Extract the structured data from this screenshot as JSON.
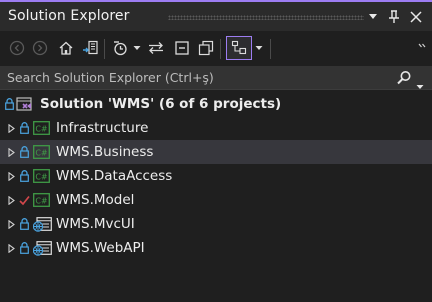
{
  "window": {
    "title": "Solution Explorer",
    "buttons": [
      {
        "name": "window-options-dropdown-icon",
        "glyph": "▾"
      },
      {
        "name": "pin-icon",
        "glyph": "ᵽ"
      },
      {
        "name": "close-icon",
        "glyph": "✕"
      }
    ]
  },
  "toolbar": {
    "items": [
      "back-icon",
      "forward-icon",
      "home-icon",
      "switch-views-icon",
      "pending-changes-filter-icon",
      "sync-with-active-document-icon",
      "collapse-all-icon",
      "show-all-files-icon",
      "properties-icon",
      "preview-selected-items-icon"
    ]
  },
  "search": {
    "placeholder": "Search Solution Explorer (Ctrl+ş)"
  },
  "tree": {
    "root": {
      "label": "Solution 'WMS' (6 of 6 projects)"
    },
    "projects": [
      {
        "label": "Infrastructure",
        "type": "csharp",
        "status": "lock"
      },
      {
        "label": "WMS.Business",
        "type": "csharp",
        "status": "lock",
        "selected": true
      },
      {
        "label": "WMS.DataAccess",
        "type": "csharp",
        "status": "lock"
      },
      {
        "label": "WMS.Model",
        "type": "csharp",
        "status": "check"
      },
      {
        "label": "WMS.MvcUI",
        "type": "web",
        "status": "lock"
      },
      {
        "label": "WMS.WebAPI",
        "type": "web",
        "status": "lock"
      }
    ]
  },
  "colors": {
    "accent": "#9d7df2",
    "csharp_icon": "#3f9b46",
    "web_icon": "#4aa3df",
    "lock": "#4aa3df",
    "check": "#d1474b",
    "selected_row": "#37373d"
  }
}
